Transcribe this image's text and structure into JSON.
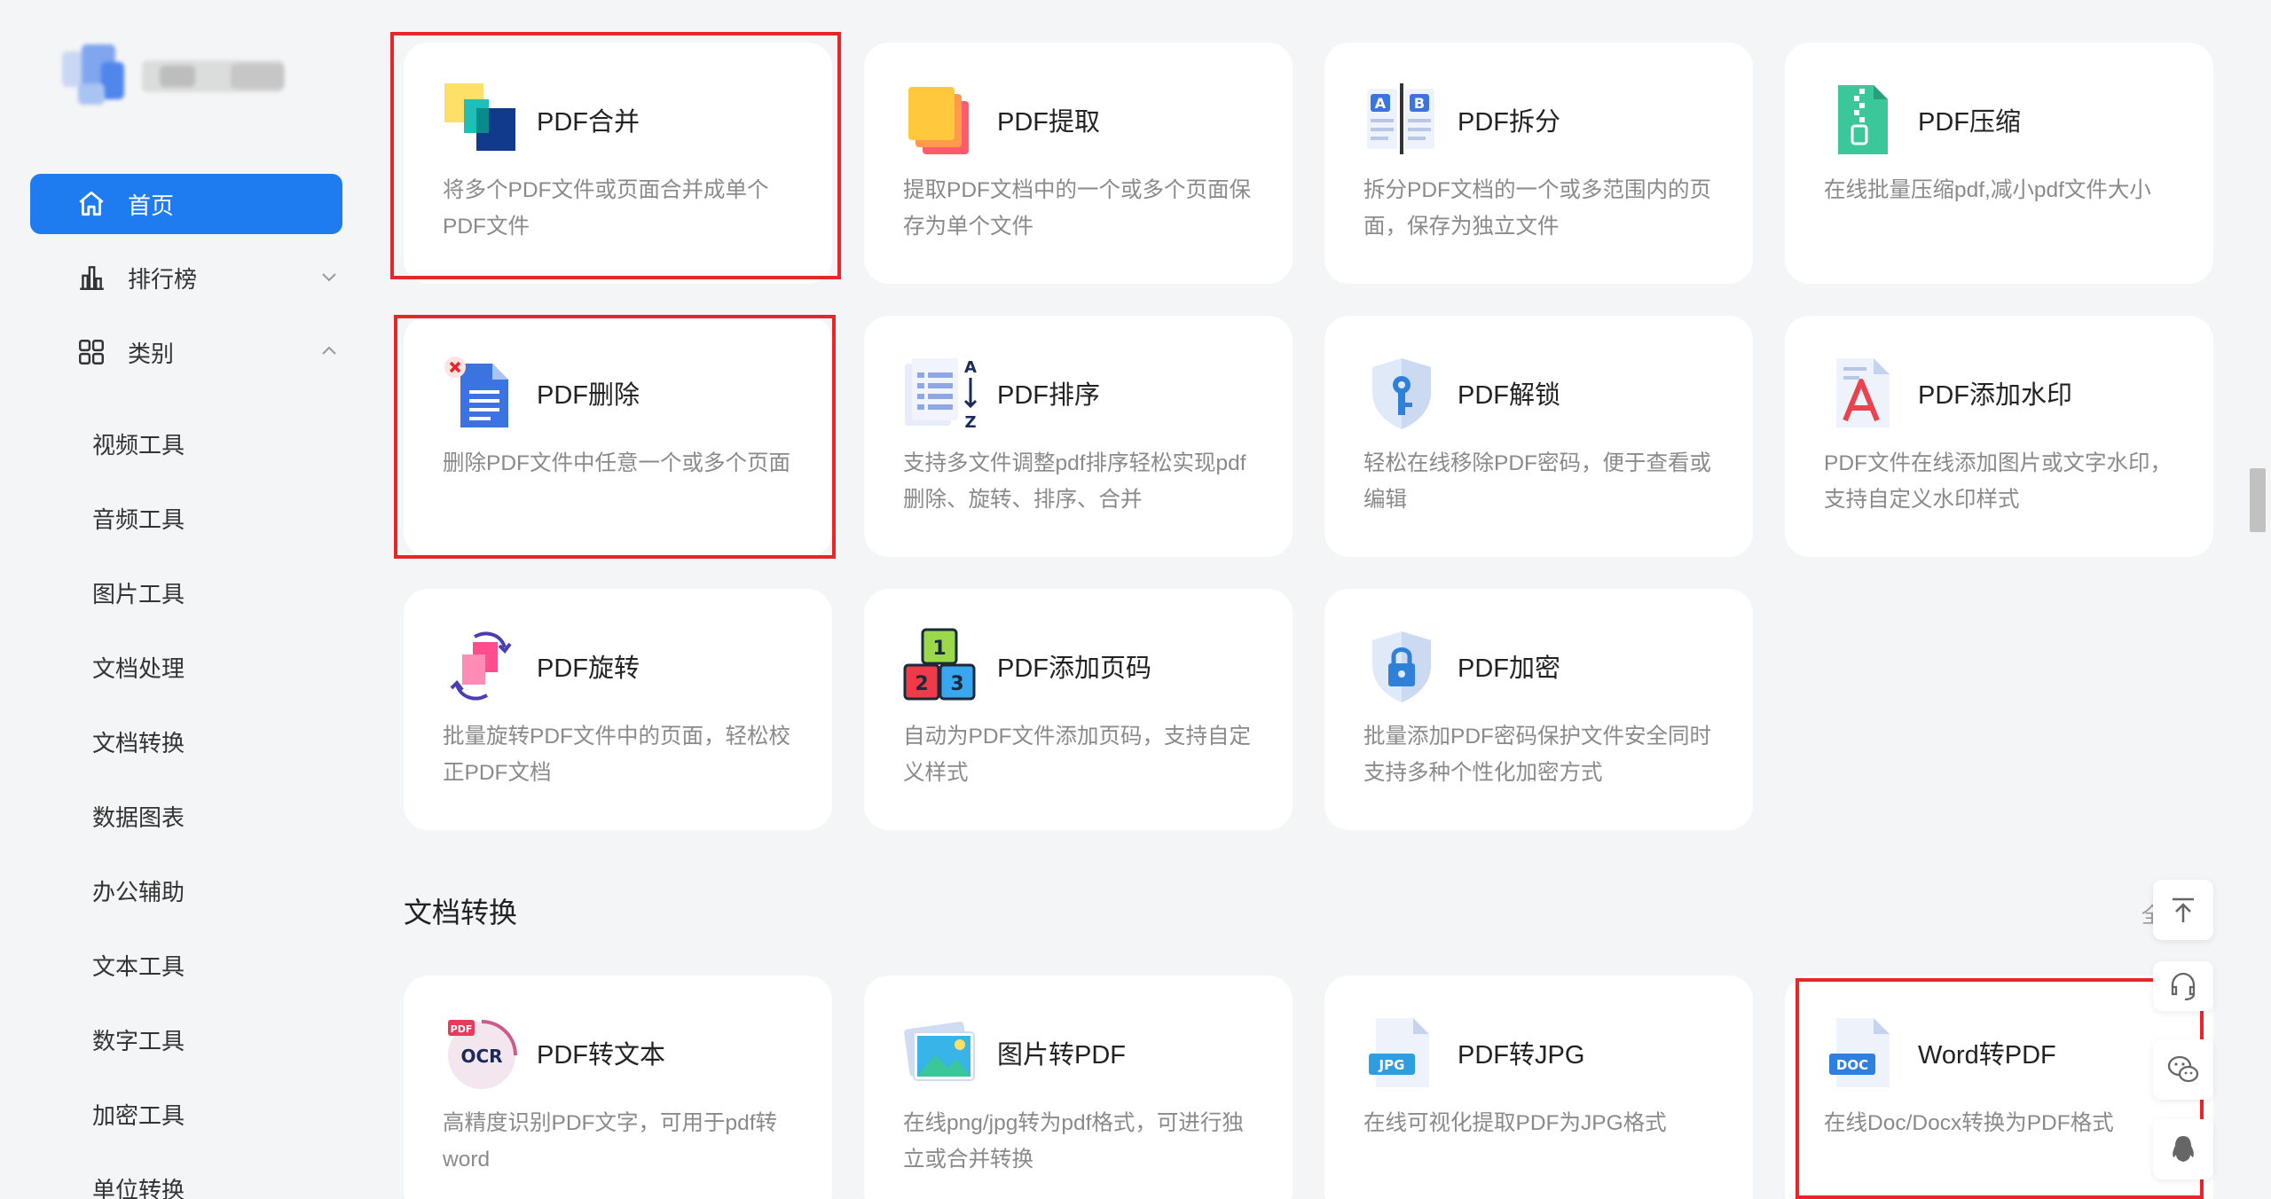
{
  "sidebar": {
    "home": "首页",
    "ranking": "排行榜",
    "category": "类别",
    "sub_items": [
      "视频工具",
      "音频工具",
      "图片工具",
      "文档处理",
      "文档转换",
      "数据图表",
      "办公辅助",
      "文本工具",
      "数字工具",
      "加密工具",
      "单位转换"
    ]
  },
  "cards": [
    {
      "title": "PDF合并",
      "desc": "将多个PDF文件或页面合并成单个PDF文件",
      "icon": "pdf-merge-icon"
    },
    {
      "title": "PDF提取",
      "desc": "提取PDF文档中的一个或多个页面保存为单个文件",
      "icon": "pdf-extract-icon"
    },
    {
      "title": "PDF拆分",
      "desc": "拆分PDF文档的一个或多范围内的页面，保存为独立文件",
      "icon": "pdf-split-icon"
    },
    {
      "title": "PDF压缩",
      "desc": "在线批量压缩pdf,减小pdf文件大小",
      "icon": "pdf-compress-icon"
    },
    {
      "title": "PDF删除",
      "desc": "删除PDF文件中任意一个或多个页面",
      "icon": "pdf-delete-icon"
    },
    {
      "title": "PDF排序",
      "desc": "支持多文件调整pdf排序轻松实现pdf删除、旋转、排序、合并",
      "icon": "pdf-sort-icon"
    },
    {
      "title": "PDF解锁",
      "desc": "轻松在线移除PDF密码，便于查看或编辑",
      "icon": "pdf-unlock-icon"
    },
    {
      "title": "PDF添加水印",
      "desc": "PDF文件在线添加图片或文字水印，支持自定义水印样式",
      "icon": "pdf-watermark-icon"
    },
    {
      "title": "PDF旋转",
      "desc": "批量旋转PDF文件中的页面，轻松校正PDF文档",
      "icon": "pdf-rotate-icon"
    },
    {
      "title": "PDF添加页码",
      "desc": "自动为PDF文件添加页码，支持自定义样式",
      "icon": "pdf-page-number-icon"
    },
    {
      "title": "PDF加密",
      "desc": "批量添加PDF密码保护文件安全同时支持多种个性化加密方式",
      "icon": "pdf-encrypt-icon"
    }
  ],
  "section": {
    "title": "文档转换",
    "more": "全部"
  },
  "conv_cards": [
    {
      "title": "PDF转文本",
      "desc": "高精度识别PDF文字，可用于pdf转word",
      "icon": "pdf-ocr-icon"
    },
    {
      "title": "图片转PDF",
      "desc": "在线png/jpg转为pdf格式，可进行独立或合并转换",
      "icon": "image-to-pdf-icon"
    },
    {
      "title": "PDF转JPG",
      "desc": "在线可视化提取PDF为JPG格式",
      "icon": "pdf-to-jpg-icon"
    },
    {
      "title": "Word转PDF",
      "desc": "在线Doc/Docx转换为PDF格式",
      "icon": "word-to-pdf-icon"
    }
  ],
  "icon_text": {
    "ocr_top": "PDF",
    "ocr": "OCR",
    "jpg": "JPG",
    "doc": "DOC",
    "split_a": "A",
    "split_b": "B",
    "sort_a": "A",
    "sort_z": "Z",
    "num1": "1",
    "num2": "2",
    "num3": "3"
  },
  "colors": {
    "accent": "#1e7cf0",
    "highlight": "#e8262a"
  }
}
